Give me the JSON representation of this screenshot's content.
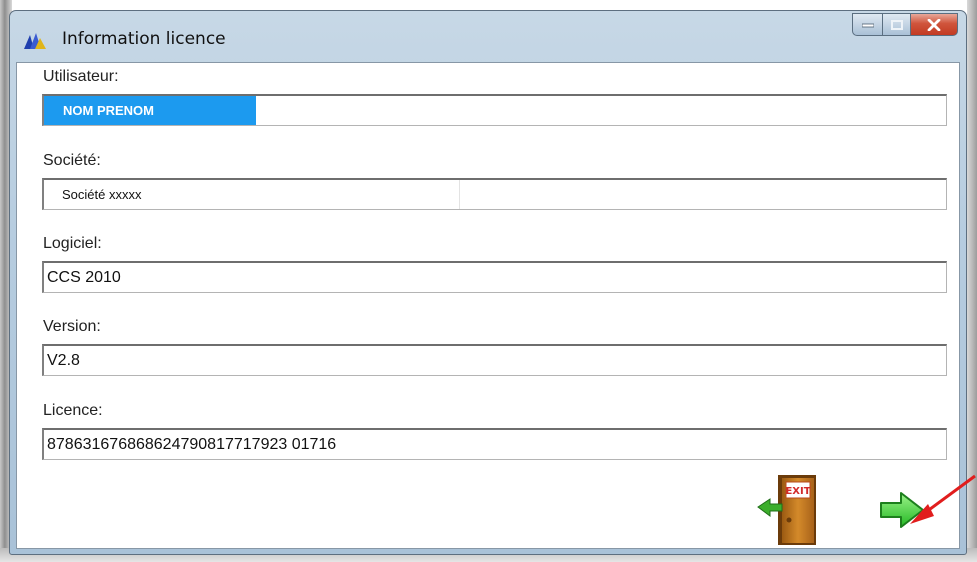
{
  "window": {
    "title": "Information licence"
  },
  "fields": {
    "user": {
      "label": "Utilisateur:",
      "value": "NOM PRENOM"
    },
    "company": {
      "label": "Société:",
      "value": "Société xxxxx"
    },
    "software": {
      "label": "Logiciel:",
      "value": "CCS 2010"
    },
    "version": {
      "label": "Version:",
      "value": "V2.8"
    },
    "licence": {
      "label": "Licence:",
      "value": "878631676868624790817717923 01716"
    }
  },
  "buttons": {
    "exit_label": "EXIT"
  },
  "icons": {
    "app": "app-logo-icon",
    "minimize": "minimize-icon",
    "maximize": "maximize-icon",
    "close": "close-icon",
    "exit": "exit-door-icon",
    "next": "green-arrow-right-icon",
    "annotation": "red-annotation-arrow"
  },
  "colors": {
    "highlight": "#1c9aef",
    "close_button": "#c9432a",
    "next_arrow": "#2ec42e",
    "annotation_arrow": "#e11d1d"
  }
}
